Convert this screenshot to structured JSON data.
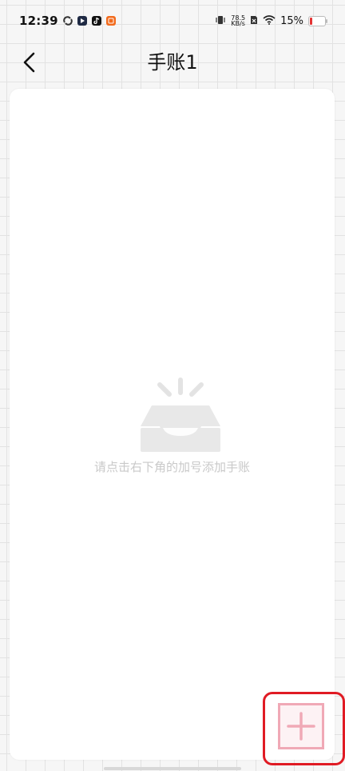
{
  "status_bar": {
    "time": "12:39",
    "net_speed_value": "78.5",
    "net_speed_unit": "KB/s",
    "battery_percent": "15%",
    "battery_level": 0.15,
    "icons": [
      "sync-icon",
      "play-icon",
      "tiktok-icon",
      "app-icon",
      "vibrate-icon",
      "no-sim-icon",
      "wifi-icon",
      "battery-icon"
    ],
    "colors": {
      "battery_low": "#e33333"
    }
  },
  "header": {
    "title": "手账1",
    "back_icon": "chevron-left-icon"
  },
  "empty_state": {
    "icon": "empty-inbox-icon",
    "message": "请点击右下角的加号添加手账"
  },
  "fab": {
    "icon": "plus-icon",
    "accent_color": "#f0a9b6",
    "highlight_color": "#e01b24"
  }
}
